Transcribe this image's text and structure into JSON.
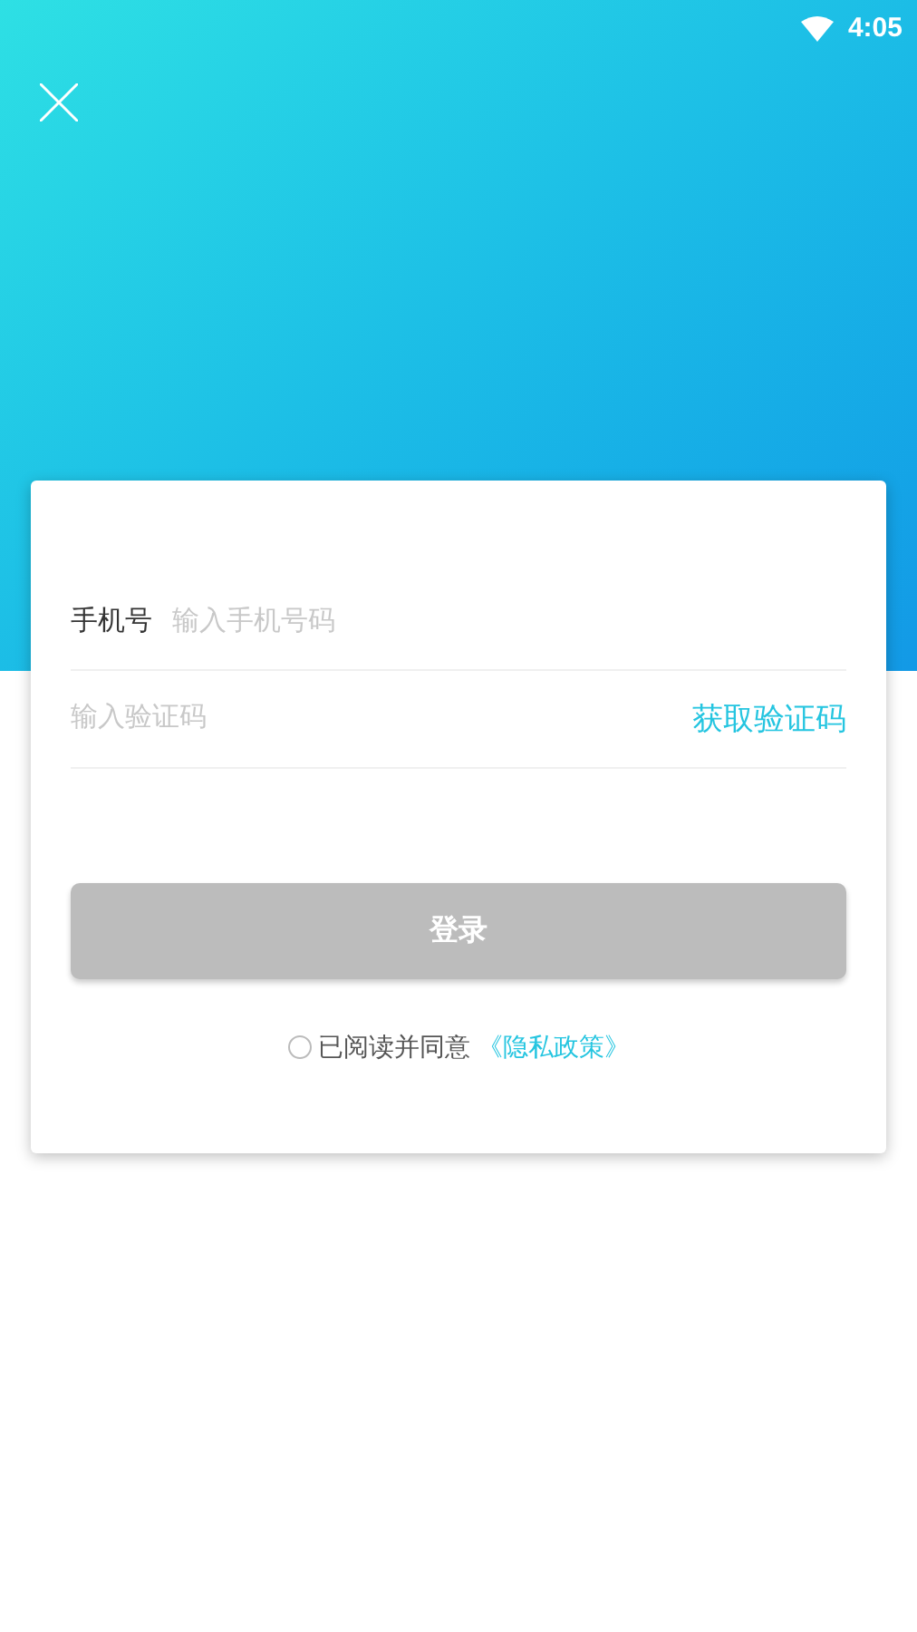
{
  "status_bar": {
    "time": "4:05"
  },
  "login_form": {
    "phone_label": "手机号",
    "phone_placeholder": "输入手机号码",
    "code_placeholder": "输入验证码",
    "get_code_link": "获取验证码",
    "login_button": {
      "label": "登录",
      "disabled": true
    },
    "agreement": {
      "checked": false,
      "text": "已阅读并同意",
      "link": "《隐私政策》"
    }
  }
}
